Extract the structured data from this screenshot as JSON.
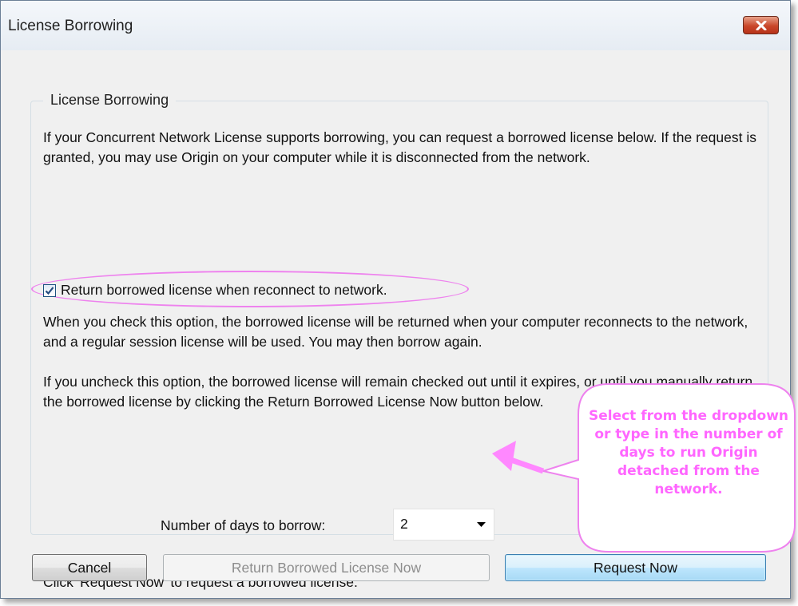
{
  "window": {
    "title": "License Borrowing"
  },
  "group": {
    "title": "License Borrowing",
    "intro": "If your Concurrent Network License supports borrowing, you can request a borrowed license below. If the request is granted, you may use Origin on your computer while it is disconnected from the network.",
    "checkbox": {
      "label": "Return borrowed license when reconnect to network.",
      "checked": true
    },
    "checked_info": "When you check this option, the borrowed license will be returned when your computer reconnects to the network, and a regular session license will be used. You may then borrow again.",
    "unchecked_info": "If you uncheck this option, the borrowed license will remain checked out until it expires, or until you manually return the borrowed license by clicking the Return Borrowed License Now button below.",
    "days_label": "Number of days to borrow:",
    "days_value": "2",
    "footer": "Click 'Request Now' to request a borrowed license."
  },
  "buttons": {
    "cancel": "Cancel",
    "return_now": "Return Borrowed License Now",
    "request_now": "Request Now"
  },
  "callout": {
    "text": "Select from the dropdown or type in the number of days to run Origin detached from the network."
  },
  "colors": {
    "annotation": "#ff66ff",
    "close_button": "#c9472a",
    "default_button_border": "#3c7fb1"
  }
}
